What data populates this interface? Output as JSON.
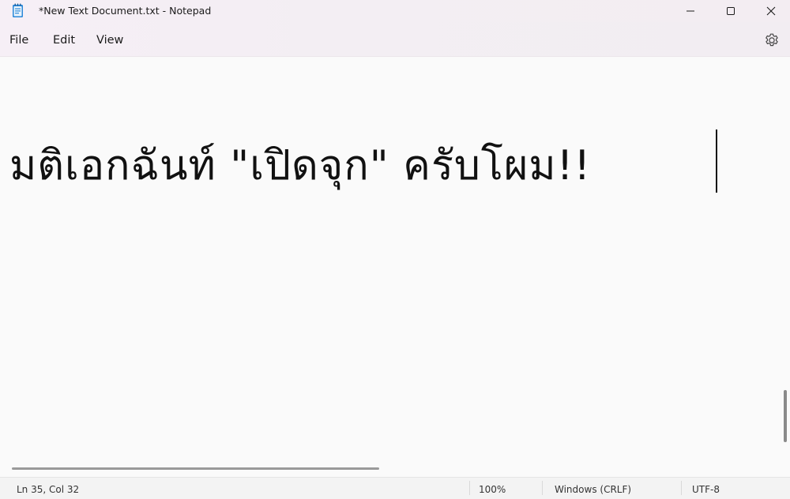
{
  "window": {
    "title": "*New Text Document.txt - Notepad",
    "app_icon": "notepad-icon",
    "controls": {
      "minimize_icon": "minimize-icon",
      "maximize_icon": "maximize-icon",
      "close_icon": "close-icon"
    }
  },
  "menu": {
    "items": [
      {
        "label": "File"
      },
      {
        "label": "Edit"
      },
      {
        "label": "View"
      }
    ],
    "settings_icon": "gear-icon"
  },
  "editor": {
    "text": "มติเอกฉันท์ \"เปิดจุก\" ครับโผม!!"
  },
  "status": {
    "position": "Ln 35, Col 32",
    "zoom": "100%",
    "line_ending": "Windows (CRLF)",
    "encoding": "UTF-8"
  },
  "colors": {
    "titlebar_tint": "#f6eff6",
    "editor_bg": "#fafafa",
    "statusbar_bg": "#f3f3f3",
    "notepad_icon_blue": "#2b88d8"
  }
}
